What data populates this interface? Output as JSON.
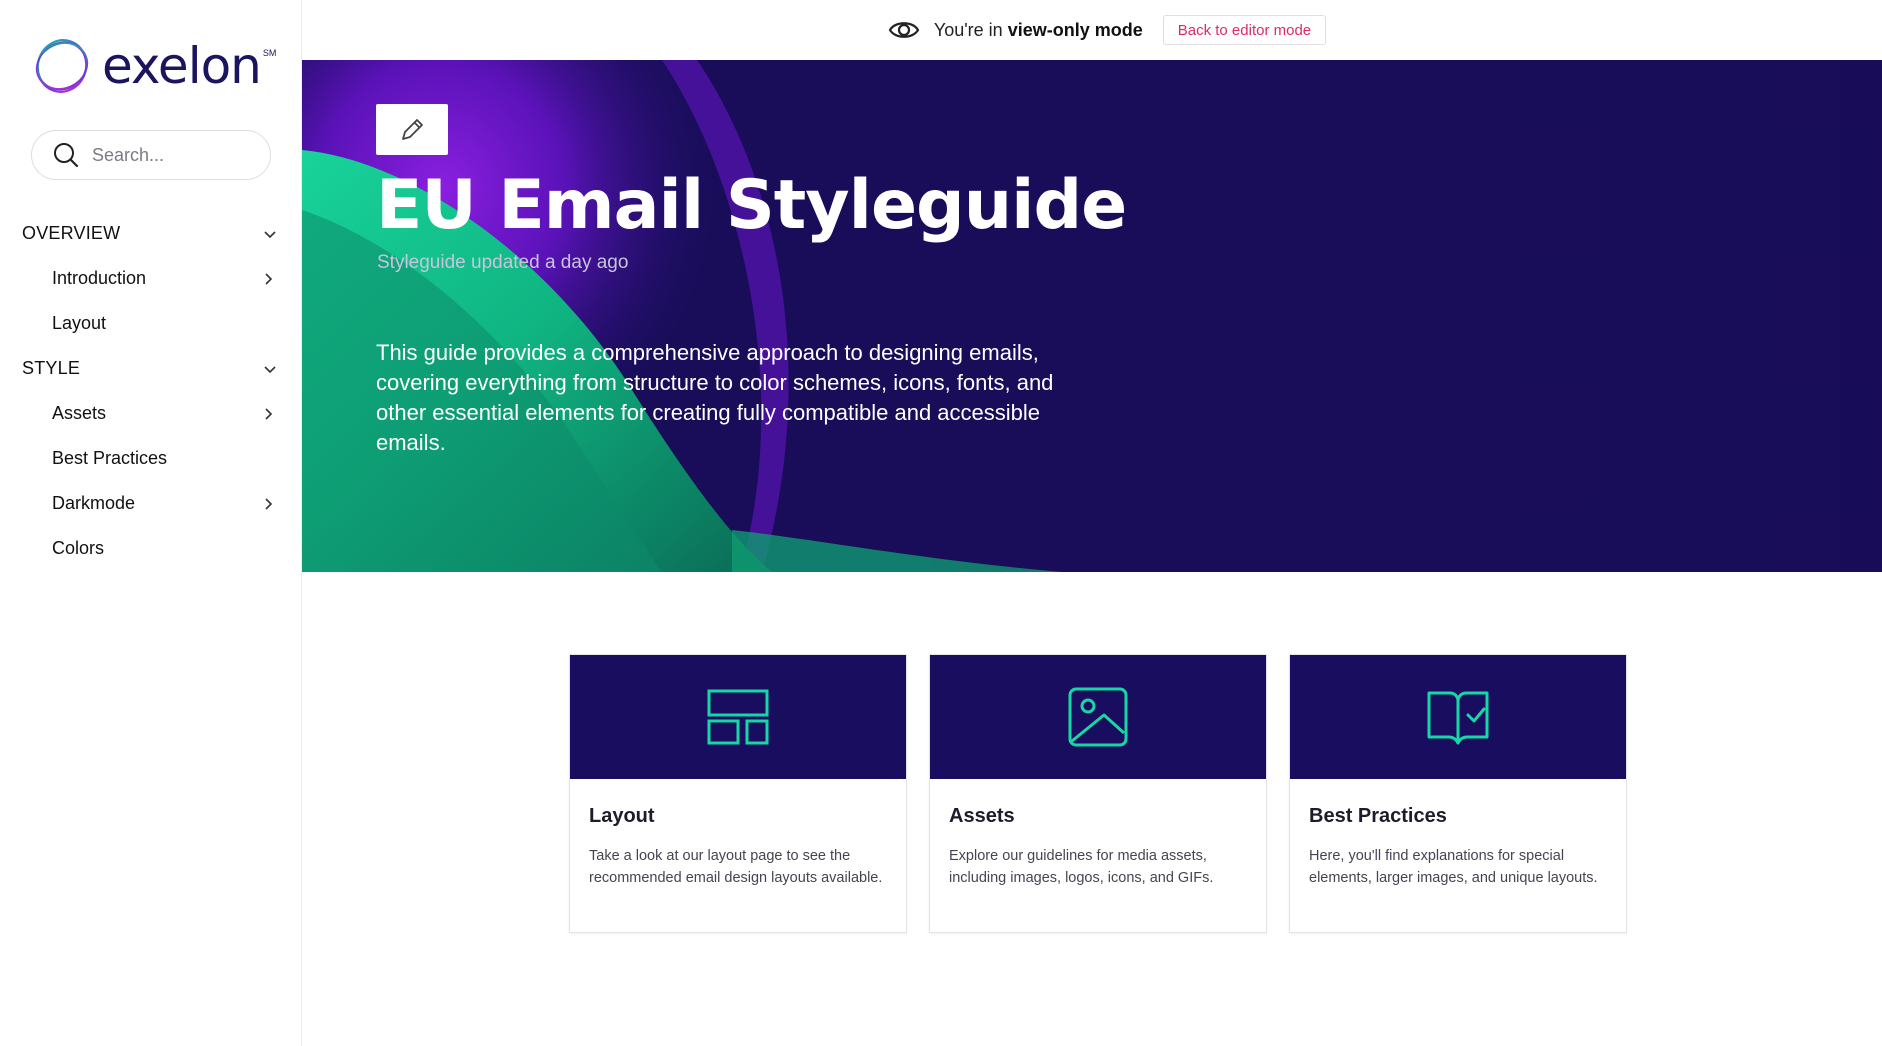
{
  "brand": {
    "name": "exelon",
    "mark": "SM"
  },
  "search": {
    "placeholder": "Search..."
  },
  "nav": {
    "sections": [
      {
        "label": "OVERVIEW",
        "items": [
          {
            "label": "Introduction",
            "has_children": true
          },
          {
            "label": "Layout",
            "has_children": false
          }
        ]
      },
      {
        "label": "STYLE",
        "items": [
          {
            "label": "Assets",
            "has_children": true
          },
          {
            "label": "Best Practices",
            "has_children": false
          },
          {
            "label": "Darkmode",
            "has_children": true
          },
          {
            "label": "Colors",
            "has_children": false
          }
        ]
      }
    ]
  },
  "topbar": {
    "prefix": "You're in",
    "mode": "view-only mode",
    "editor_button": "Back to editor mode"
  },
  "hero": {
    "title": "EU Email Styleguide",
    "updated": "Styleguide updated a day ago",
    "description": "This guide provides a comprehensive approach to designing emails, covering everything from structure to color schemes, icons, fonts, and other essential elements for creating fully compatible and accessible emails."
  },
  "cards": [
    {
      "icon": "layout-icon",
      "title": "Layout",
      "text": "Take a look at our layout page to see the recommended email design layouts available."
    },
    {
      "icon": "image-icon",
      "title": "Assets",
      "text": "Explore our guidelines for media assets, including images, logos, icons, and GIFs."
    },
    {
      "icon": "book-check-icon",
      "title": "Best Practices",
      "text": "Here, you'll find explanations for special elements, larger images, and unique layouts."
    }
  ],
  "colors": {
    "brand_navy": "#1b145f",
    "hero_bg": "#190d5a",
    "accent_green": "#18c58f",
    "accent_purple": "#7a1fd6",
    "link_pink": "#e0296a"
  }
}
